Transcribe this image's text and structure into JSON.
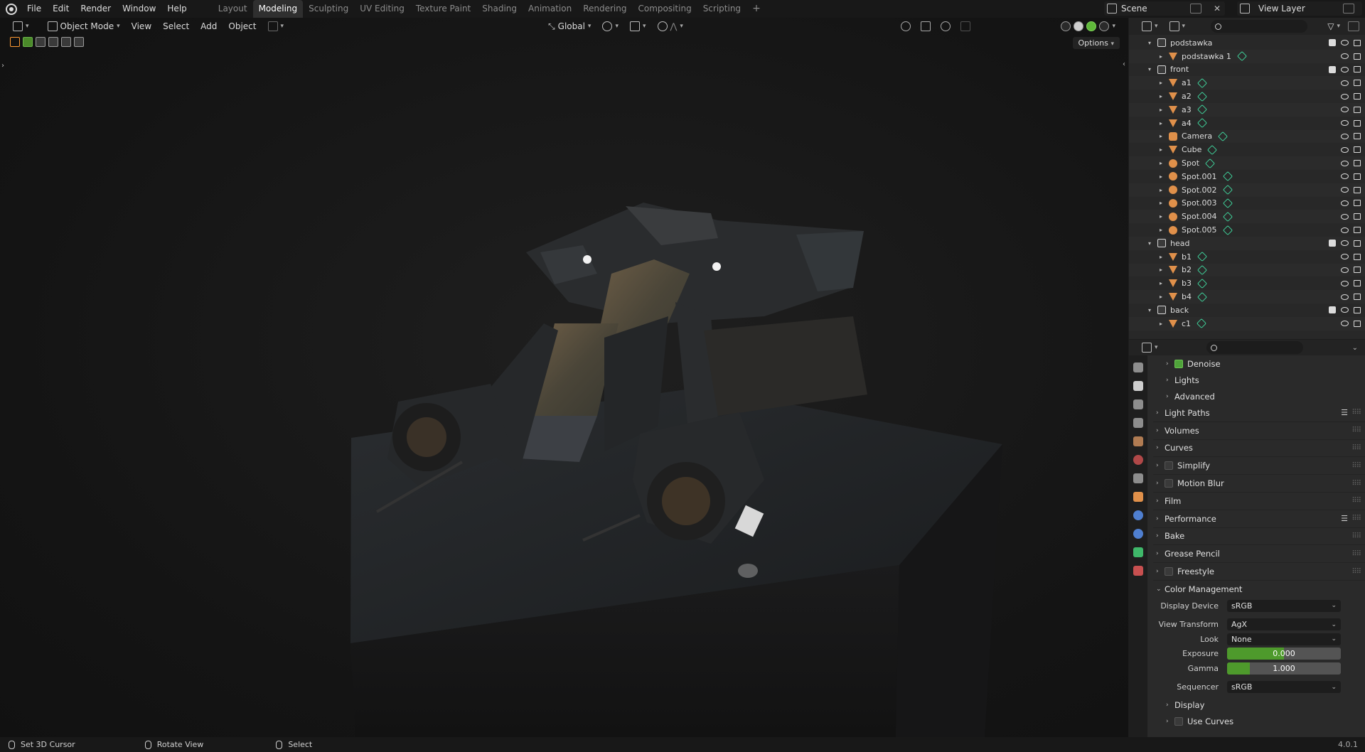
{
  "topbar": {
    "menu": [
      "File",
      "Edit",
      "Render",
      "Window",
      "Help"
    ],
    "workspaces": [
      "Layout",
      "Modeling",
      "Sculpting",
      "UV Editing",
      "Texture Paint",
      "Shading",
      "Animation",
      "Rendering",
      "Compositing",
      "Scripting"
    ],
    "active_workspace": "Modeling",
    "add_tab": "+",
    "scene": "Scene",
    "view_layer": "View Layer"
  },
  "viewport": {
    "mode": "Object Mode",
    "menus": [
      "View",
      "Select",
      "Add",
      "Object"
    ],
    "transform_orientation": "Global",
    "options_label": "Options"
  },
  "outliner": {
    "rows": [
      {
        "name": "podstawka",
        "type": "collection",
        "level": 0
      },
      {
        "name": "podstawka 1",
        "type": "mesh",
        "level": 1
      },
      {
        "name": "front",
        "type": "collection",
        "level": 0
      },
      {
        "name": "a1",
        "type": "mesh",
        "level": 1
      },
      {
        "name": "a2",
        "type": "mesh",
        "level": 1
      },
      {
        "name": "a3",
        "type": "mesh",
        "level": 1
      },
      {
        "name": "a4",
        "type": "mesh",
        "level": 1
      },
      {
        "name": "Camera",
        "type": "camera",
        "level": 1
      },
      {
        "name": "Cube",
        "type": "mesh",
        "level": 1
      },
      {
        "name": "Spot",
        "type": "light",
        "level": 1
      },
      {
        "name": "Spot.001",
        "type": "light",
        "level": 1
      },
      {
        "name": "Spot.002",
        "type": "light",
        "level": 1
      },
      {
        "name": "Spot.003",
        "type": "light",
        "level": 1
      },
      {
        "name": "Spot.004",
        "type": "light",
        "level": 1
      },
      {
        "name": "Spot.005",
        "type": "light",
        "level": 1
      },
      {
        "name": "head",
        "type": "collection",
        "level": 0
      },
      {
        "name": "b1",
        "type": "mesh",
        "level": 1
      },
      {
        "name": "b2",
        "type": "mesh",
        "level": 1
      },
      {
        "name": "b3",
        "type": "mesh",
        "level": 1
      },
      {
        "name": "b4",
        "type": "mesh",
        "level": 1
      },
      {
        "name": "back",
        "type": "collection",
        "level": 0
      },
      {
        "name": "c1",
        "type": "mesh",
        "level": 1
      }
    ]
  },
  "properties": {
    "sub_sections": [
      {
        "label": "Denoise",
        "checkbox": true
      },
      {
        "label": "Lights"
      },
      {
        "label": "Advanced"
      }
    ],
    "sections": [
      {
        "label": "Light Paths",
        "list_icon": true
      },
      {
        "label": "Volumes"
      },
      {
        "label": "Curves"
      },
      {
        "label": "Simplify",
        "checkbox": false
      },
      {
        "label": "Motion Blur",
        "checkbox": false
      },
      {
        "label": "Film"
      },
      {
        "label": "Performance",
        "list_icon": true
      },
      {
        "label": "Bake"
      },
      {
        "label": "Grease Pencil"
      },
      {
        "label": "Freestyle",
        "checkbox": false
      }
    ],
    "color_management": {
      "label": "Color Management",
      "display_device_label": "Display Device",
      "display_device": "sRGB",
      "view_transform_label": "View Transform",
      "view_transform": "AgX",
      "look_label": "Look",
      "look": "None",
      "exposure_label": "Exposure",
      "exposure": "0.000",
      "exposure_fill": 0.5,
      "gamma_label": "Gamma",
      "gamma": "1.000",
      "gamma_fill": 0.2,
      "sequencer_label": "Sequencer",
      "sequencer": "sRGB",
      "display_sub": "Display",
      "use_curves_sub": "Use Curves"
    }
  },
  "statusbar": {
    "items": [
      "Set 3D Cursor",
      "Rotate View",
      "Select"
    ],
    "version": "4.0.1"
  },
  "colors": {
    "accent_green": "#4e9a2c",
    "mesh_orange": "#e0904a",
    "data_teal": "#3fd29a"
  }
}
